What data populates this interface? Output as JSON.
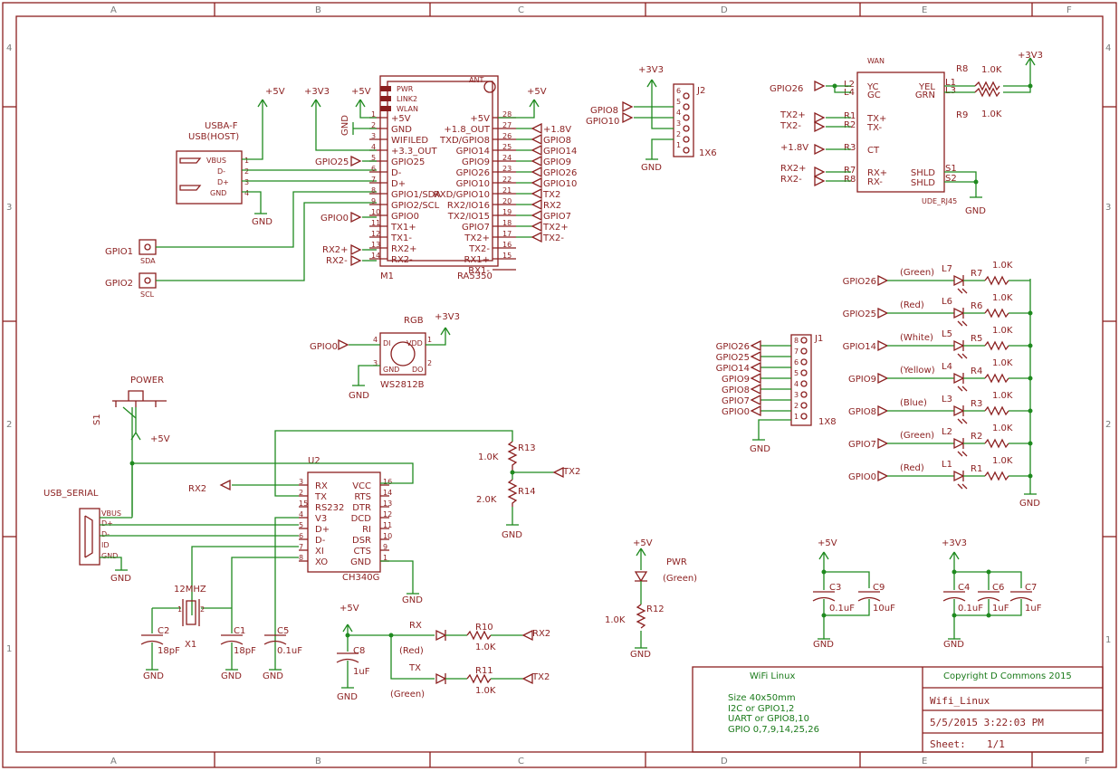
{
  "frame": {
    "columns": [
      "A",
      "B",
      "C",
      "D",
      "E",
      "F"
    ],
    "rows": [
      "4",
      "3",
      "2",
      "1"
    ]
  },
  "usb_host": {
    "name": "USBA-F",
    "value": "USB(HOST)",
    "pins": [
      "VBUS",
      "D-",
      "D+",
      "GND"
    ],
    "pin_numbers": [
      "1",
      "2",
      "3",
      "4"
    ]
  },
  "module": {
    "name": "M1",
    "value": "RA5350",
    "leds": [
      "PWR",
      "LINK2",
      "WLAN"
    ],
    "ant": "ANT",
    "left_pins": [
      "+5V",
      "GND",
      "WIFILED",
      "+3.3_OUT",
      "GPIO25",
      "D-",
      "D+",
      "GPIO1/SDA",
      "GPIO2/SCL",
      "GPIO0",
      "TX1+",
      "TX1-",
      "RX2+",
      "RX2-"
    ],
    "left_numbers": [
      "1",
      "2",
      "3",
      "4",
      "5",
      "6",
      "7",
      "8",
      "9",
      "10",
      "11",
      "12",
      "13",
      "14"
    ],
    "right_pins": [
      "+5V",
      "+1.8_OUT",
      "TXD/GPIO8",
      "GPIO14",
      "GPIO9",
      "GPIO26",
      "GPIO10",
      "RXD/GPIO10",
      "RX2/IO16",
      "TX2/IO15",
      "GPIO7",
      "TX2+",
      "TX2-",
      "RX1+",
      "RX1-"
    ],
    "right_numbers": [
      "28",
      "27",
      "26",
      "25",
      "24",
      "23",
      "22",
      "21",
      "20",
      "19",
      "18",
      "17",
      "16",
      "15"
    ],
    "right_nets": [
      "+1.8V",
      "GPIO8",
      "GPIO14",
      "GPIO9",
      "GPIO26",
      "GPIO10",
      "TX2",
      "RX2",
      "GPIO7",
      "TX2+",
      "TX2-"
    ]
  },
  "power": {
    "v5": "+5V",
    "v33": "+3V3",
    "gnd": "GND"
  },
  "nets": {
    "gpio25": "GPIO25",
    "gpio0": "GPIO0",
    "gpio1": "GPIO1",
    "gpio2": "GPIO2",
    "gpio8": "GPIO8",
    "gpio10": "GPIO10",
    "gpio26": "GPIO26",
    "rx2p": "RX2+",
    "rx2m": "RX2-",
    "tx2p": "TX2+",
    "tx2m": "TX2-",
    "rx2": "RX2",
    "tx2": "TX2",
    "v18": "+1.8V"
  },
  "sda_pad": "SDA",
  "scl_pad": "SCL",
  "j2": {
    "name": "J2",
    "value": "1X6",
    "pins": [
      "6",
      "5",
      "4",
      "3",
      "2",
      "1"
    ]
  },
  "wan": {
    "title": "WAN",
    "value": "UDE_RJ45",
    "left_pins": [
      "YC",
      "GC",
      "TX+",
      "TX-",
      "CT",
      "RX+",
      "RX-"
    ],
    "right_pins": [
      "YEL",
      "GRN",
      "SHLD",
      "SHLD"
    ],
    "left_pads": [
      "L2",
      "L4",
      "R1",
      "R2",
      "R3",
      "R7",
      "R8"
    ],
    "right_pads": [
      "L1",
      "L3",
      "S1",
      "S2"
    ],
    "r8": "R8",
    "r9": "R9",
    "r_value": "1.0K"
  },
  "rgb": {
    "label": "RGB",
    "value": "WS2812B",
    "pins": [
      "DI",
      "VDD",
      "GND",
      "DO"
    ],
    "numbers": [
      "4",
      "1",
      "3",
      "2"
    ]
  },
  "j1": {
    "name": "J1",
    "value": "1X8",
    "pins": [
      "8",
      "7",
      "6",
      "5",
      "4",
      "3",
      "2",
      "1"
    ],
    "nets": [
      "GPIO26",
      "GPIO25",
      "GPIO14",
      "GPIO9",
      "GPIO8",
      "GPIO7",
      "GPIO0"
    ]
  },
  "led_bank": [
    {
      "net": "GPIO26",
      "color": "(Green)",
      "led": "L7",
      "res": "R7",
      "value": "1.0K"
    },
    {
      "net": "GPIO25",
      "color": "(Red)",
      "led": "L6",
      "res": "R6",
      "value": "1.0K"
    },
    {
      "net": "GPIO14",
      "color": "(White)",
      "led": "L5",
      "res": "R5",
      "value": "1.0K"
    },
    {
      "net": "GPIO9",
      "color": "(Yellow)",
      "led": "L4",
      "res": "R4",
      "value": "1.0K"
    },
    {
      "net": "GPIO8",
      "color": "(Blue)",
      "led": "L3",
      "res": "R3",
      "value": "1.0K"
    },
    {
      "net": "GPIO7",
      "color": "(Green)",
      "led": "L2",
      "res": "R2",
      "value": "1.0K"
    },
    {
      "net": "GPIO0",
      "color": "(Red)",
      "led": "L1",
      "res": "R1",
      "value": "1.0K"
    }
  ],
  "power_switch": {
    "name": "S1",
    "value": "POWER"
  },
  "usb_serial": {
    "value": "USB_SERIAL",
    "pins": [
      "VBUS",
      "D+",
      "D-",
      "ID",
      "GND"
    ]
  },
  "ch340": {
    "name": "U2",
    "value": "CH340G",
    "left_pins": [
      "RX",
      "TX",
      "RS232",
      "V3",
      "D+",
      "D-",
      "XI",
      "XO"
    ],
    "left_numbers": [
      "3",
      "2",
      "15",
      "4",
      "5",
      "6",
      "7",
      "8"
    ],
    "right_pins": [
      "VCC",
      "RTS",
      "DTR",
      "DCD",
      "RI",
      "DSR",
      "CTS",
      "GND"
    ],
    "right_numbers": [
      "16",
      "14",
      "13",
      "12",
      "11",
      "10",
      "9",
      "1"
    ]
  },
  "divider": {
    "r13": "R13",
    "r13_value": "1.0K",
    "r14": "R14",
    "r14_value": "2.0K"
  },
  "crystal": {
    "name": "X1",
    "value": "12MHZ",
    "pin1": "1",
    "pin2": "2"
  },
  "caps": {
    "c2": "C2",
    "c2v": "18pF",
    "c1": "C1",
    "c1v": "18pF",
    "c5": "C5",
    "c5v": "0.1uF",
    "c8": "C8",
    "c8v": "1uF",
    "c3": "C3",
    "c3v": "0.1uF",
    "c9": "C9",
    "c9v": "10uF",
    "c4": "C4",
    "c4v": "0.1uF",
    "c6": "C6",
    "c6v": "1uF",
    "c7": "C7",
    "c7v": "1uF"
  },
  "rxtx_leds": {
    "rx": "RX",
    "rx_color": "(Red)",
    "r10": "R10",
    "r10v": "1.0K",
    "tx": "TX",
    "tx_color": "(Green)",
    "r11": "R11",
    "r11v": "1.0K"
  },
  "pwr_led": {
    "label": "PWR",
    "color": "(Green)",
    "r12": "R12",
    "r12v": "1.0K"
  },
  "title_block": {
    "project": "WiFi Linux",
    "notes": [
      "Size 40x50mm",
      "I2C or GPIO1,2",
      "UART or GPIO8,10",
      "GPIO 0,7,9,14,25,26"
    ],
    "copyright": "Copyright D Commons 2015",
    "name": "Wifi_Linux",
    "date": "5/5/2015 3:22:03 PM",
    "sheet_label": "Sheet:",
    "sheet_value": "1/1"
  }
}
